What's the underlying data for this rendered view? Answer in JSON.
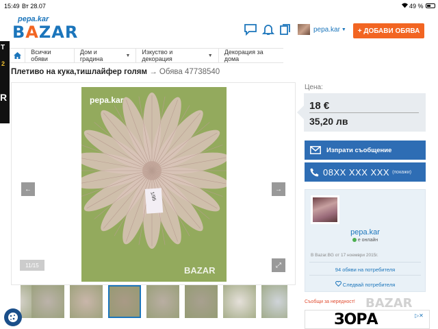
{
  "status_bar": {
    "time": "15:49",
    "date": "Вт 28.07",
    "battery": "49 %",
    "battery_level": 0.49
  },
  "header": {
    "logo_tagline": "pepa.kar",
    "logo_text": "BAZAR",
    "user_name": "pepa.kar",
    "add_button": "+ ДОБАВИ ОБЯВА"
  },
  "breadcrumb": [
    "Всички обяви",
    "Дом и градина",
    "Изкуство и декорация",
    "Декорация за дома"
  ],
  "left_ad": {
    "lines": [
      "T",
      "2",
      "R"
    ]
  },
  "listing": {
    "title": "Плетиво на кука,тишлайфер голям",
    "id_text": "→ Обява 47738540",
    "photo_watermark": "pepa.kar",
    "photo_counter": "11/15",
    "photo_brand": "BAZAR",
    "note_text": "1/95"
  },
  "thumbnails": {
    "count": 8,
    "active_index": 3
  },
  "price": {
    "label": "Цена:",
    "eur": "18 €",
    "bgn": "35,20 лв"
  },
  "contact": {
    "message_button": "Изпрати съобщение",
    "phone": "08XX XXX XXX",
    "phone_show": "(покажи)"
  },
  "seller": {
    "name": "pepa.kar",
    "status": "е онлайн",
    "since": "В Bazar.BG от 17 ноември 2015г.",
    "ads_link": "94 обяви на потребителя",
    "follow": "Следвай потребителя"
  },
  "report_link": "Съобщи за нередност!",
  "ad_banner": {
    "brand": "ЗОРА",
    "bazar_overlay": "BAZAR",
    "ad_mark": "▷✕"
  },
  "colors": {
    "brand_blue": "#1b75bb",
    "accent_orange": "#f26522",
    "button_blue": "#2e6db4"
  }
}
